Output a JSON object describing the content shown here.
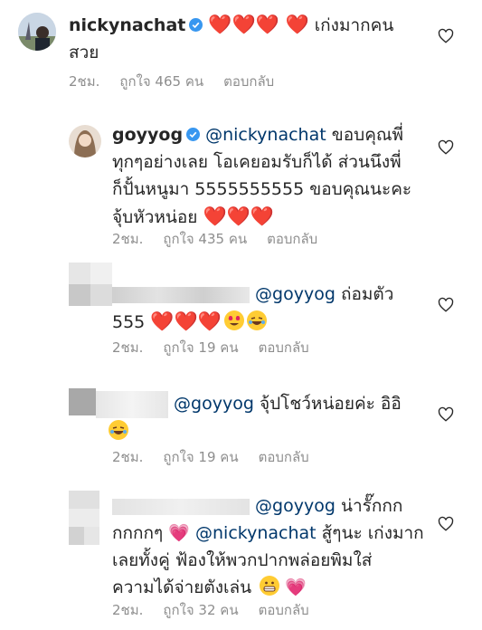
{
  "comments": [
    {
      "username": "nickynachat",
      "verified": true,
      "text_line1": "เก่งมากคน",
      "text_line2": "สวย",
      "time": "2ชม.",
      "likes": "ถูกใจ 465 คน",
      "reply": "ตอบกลับ"
    },
    {
      "username": "goyyog",
      "verified": true,
      "mention": "@nickynachat",
      "text_a": "ขอบคุณพี่",
      "text_line2": "ทุกๆอย่างเลย โอเคยอมรับก็ได้ ส่วนนึงพี่",
      "text_line3": "ก็ปั้นหนูมา 5555555555 ขอบคุณนะคะ",
      "text_line4": "จุ้บหัวหน่อย",
      "time": "2ชม.",
      "likes": "ถูกใจ 435 คน",
      "reply": "ตอบกลับ"
    },
    {
      "mention": "@goyyog",
      "text_a": "ถ่อมตัว",
      "text_line2": "555",
      "time": "2ชม.",
      "likes": "ถูกใจ 19 คน",
      "reply": "ตอบกลับ"
    },
    {
      "mention": "@goyyog",
      "text_a": "จุ้ปโชว์หน่อยค่ะ อิอิ",
      "time": "2ชม.",
      "likes": "ถูกใจ 19 คน",
      "reply": "ตอบกลับ"
    },
    {
      "mention": "@goyyog",
      "text_a": "น่ารั๊กกก",
      "text_line2a": "กกกกๆ",
      "mention2": "@nickynachat",
      "text_line2b": "สู้ๆนะ เก่งมาก",
      "text_line3": "เลยทั้งคู่ ฟ้องให้พวกปากพล่อยพิมใส่",
      "text_line4": "ความได้จ่ายตังเล่น",
      "time": "2ชม.",
      "likes": "ถูกใจ 32 คน",
      "reply": "ตอบกลับ"
    }
  ],
  "colors": {
    "text": "#262626",
    "mention": "#00376b",
    "meta": "#8e8e8e",
    "heart": "#ed4956",
    "verified": "#3897f0"
  }
}
